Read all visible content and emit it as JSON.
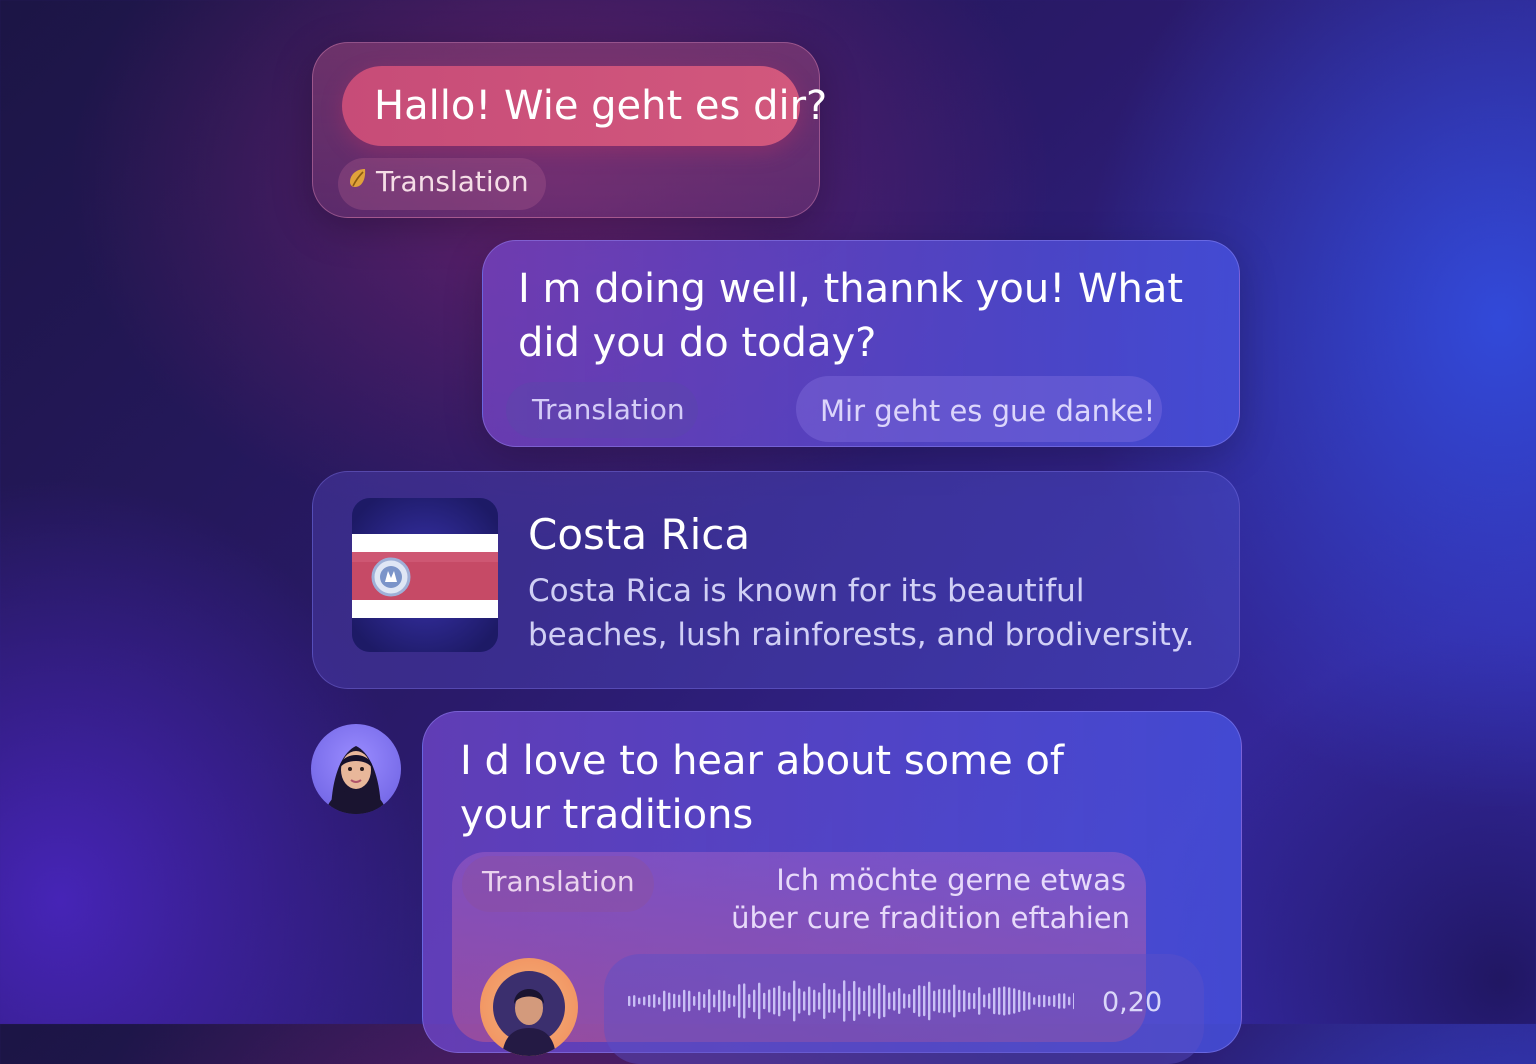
{
  "colors": {
    "accent_pink": "#d2587d",
    "accent_blue": "#4b55e0",
    "flag_blue": "#24207a",
    "flag_red": "#c64a66",
    "avatar_orange": "#ef8c5c"
  },
  "messages": [
    {
      "id": "m1",
      "text": "Hallo! Wie geht es dir?",
      "translation_label": "Translation",
      "icon": "leaf-icon"
    },
    {
      "id": "m2",
      "text": "I m doing well,  thannk you! What did you do today?",
      "translation_label": "Translation",
      "translation_text": "Mir geht es gue danke!"
    },
    {
      "id": "m3",
      "text": "I d love to hear about some of your traditions",
      "translation_label": "Translation",
      "translation_lines": [
        "Ich möchte gerne etwas",
        "über cure fradition eftahien"
      ],
      "audio": {
        "duration": "0,20",
        "icon": "waveform-icon"
      }
    }
  ],
  "info_card": {
    "title": "Costa Rica",
    "description": "Costa Rica is known for its beautiful beaches, lush rainforests, and brodiversity.",
    "icon": "costa-rica-flag-icon"
  },
  "avatars": [
    "user-avatar",
    "speaker-avatar"
  ]
}
